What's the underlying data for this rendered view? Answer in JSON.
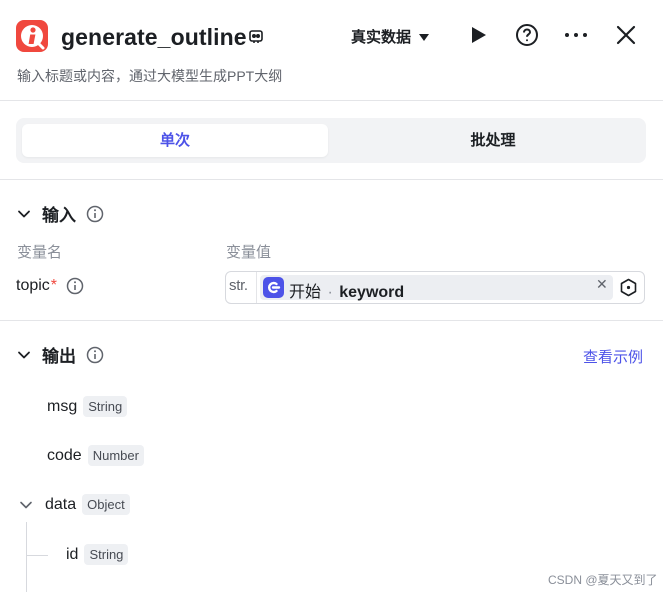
{
  "node": {
    "title": "generate_outline",
    "description": "输入标题或内容，通过大模型生成PPT大纲",
    "data_mode": "真实数据"
  },
  "tabs": [
    {
      "label": "单次",
      "active": true
    },
    {
      "label": "批处理",
      "active": false
    }
  ],
  "input": {
    "heading": "输入",
    "col_name": "变量名",
    "col_value": "变量值",
    "params": [
      {
        "name": "topic",
        "required_mark": "*",
        "type_tag": "str.",
        "ref_source": "开始",
        "ref_separator": "·",
        "ref_field": "keyword"
      }
    ]
  },
  "output": {
    "heading": "输出",
    "example_link": "查看示例",
    "fields": [
      {
        "name": "msg",
        "type": "String"
      },
      {
        "name": "code",
        "type": "Number"
      },
      {
        "name": "data",
        "type": "Object",
        "expanded": true
      },
      {
        "name": "id",
        "type": "String"
      }
    ]
  },
  "watermark": "CSDN @夏天又到了",
  "icons": {
    "logo": "plugin-logo-icon",
    "title_badge": "plugin-badge-icon",
    "run": "play-icon",
    "help": "help-circle-icon",
    "more": "more-dots-icon",
    "close": "close-icon",
    "info": "info-icon",
    "collapse": "chevron-down-icon",
    "ref": "start-node-icon",
    "var_picker": "variable-picker-icon"
  },
  "colors": {
    "accent": "#4d53e8",
    "logo": "#f0483e",
    "required": "#f0483e"
  }
}
